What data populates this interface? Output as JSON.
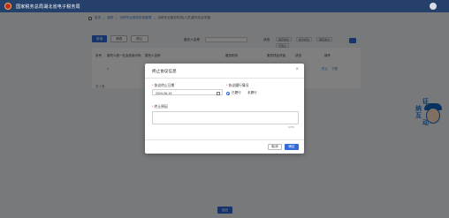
{
  "header": {
    "title": "国家税务总局湖北省电子税务局"
  },
  "breadcrumb": {
    "items": [
      "首页",
      "我的",
      "涉税专业服务机构管理",
      "涉税专业服务机构(人员)委托协议采集"
    ]
  },
  "toolbar": {
    "add": "新增",
    "modify": "修改",
    "stop": "终止"
  },
  "filters": {
    "agency_label": "委托人名称",
    "status_label": "状态",
    "status_tags": [
      "保存成功",
      "提交成功",
      "审核通过",
      "已终止"
    ]
  },
  "table": {
    "headers": [
      "序号",
      "委托人统一社会信用代码",
      "委托人名称",
      "服务机构",
      "服务项目开始",
      "状态",
      "操作"
    ],
    "row": {
      "index": "1",
      "actions": [
        "终止",
        "下载"
      ]
    },
    "total": "共 1 条"
  },
  "dialog": {
    "title": "终止协议信息",
    "close": "×",
    "date_label": "协议终止日期",
    "date_value": "2024-06-19",
    "performance_label": "协议履行情况",
    "radio_options": [
      "已履行",
      "未履行"
    ],
    "selected_option": "已履行",
    "reason_label": "终止原因",
    "counter": "0/250",
    "cancel": "取消",
    "confirm": "确定"
  },
  "bottom_button": "返回",
  "mascot": {
    "chars": [
      "征",
      "纳",
      "互",
      "动"
    ]
  },
  "colors": {
    "header": "#24406b",
    "primary": "#2f6bd6",
    "overlay": "rgba(0,0,0,0.5)"
  }
}
